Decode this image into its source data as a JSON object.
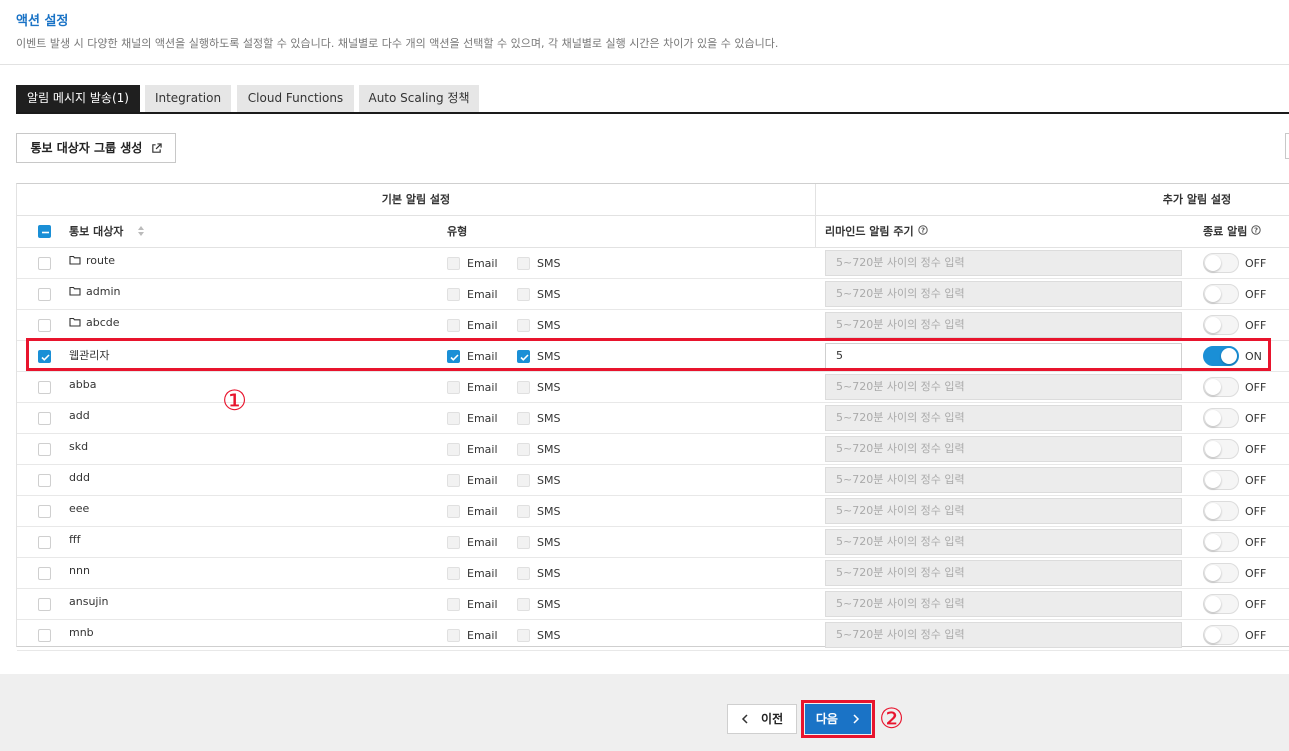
{
  "header": {
    "title": "액션 설정",
    "description": "이벤트 발생 시 다양한 채널의 액션을 실행하도록 설정할 수 있습니다. 채널별로 다수 개의 액션을 선택할 수 있으며, 각 채널별로 실행 시간은 차이가 있을 수 있습니다."
  },
  "tabs": [
    {
      "label": "알림 메시지 발송(1)",
      "active": true
    },
    {
      "label": "Integration",
      "active": false
    },
    {
      "label": "Cloud Functions",
      "active": false
    },
    {
      "label": "Auto Scaling 정책",
      "active": false
    }
  ],
  "group_button": {
    "label": "통보 대상자 그룹 생성"
  },
  "table": {
    "group_headers": {
      "basic": "기본 알림 설정",
      "additional": "추가 알림 설정"
    },
    "columns": {
      "recipient": "통보 대상자",
      "type": "유형",
      "reminder": "리마인드 알림 주기",
      "end_alert": "종료 알림"
    },
    "email_label": "Email",
    "sms_label": "SMS",
    "interval_placeholder": "5~720분 사이의 정수 입력",
    "rows": [
      {
        "name": "route",
        "folder": true,
        "checked": false,
        "interval": "",
        "end": "OFF"
      },
      {
        "name": "admin",
        "folder": true,
        "checked": false,
        "interval": "",
        "end": "OFF"
      },
      {
        "name": "abcde",
        "folder": true,
        "checked": false,
        "interval": "",
        "end": "OFF"
      },
      {
        "name": "웹관리자",
        "folder": false,
        "checked": true,
        "interval": "5",
        "end": "ON"
      },
      {
        "name": "abba",
        "folder": false,
        "checked": false,
        "interval": "",
        "end": "OFF"
      },
      {
        "name": "add",
        "folder": false,
        "checked": false,
        "interval": "",
        "end": "OFF"
      },
      {
        "name": "skd",
        "folder": false,
        "checked": false,
        "interval": "",
        "end": "OFF"
      },
      {
        "name": "ddd",
        "folder": false,
        "checked": false,
        "interval": "",
        "end": "OFF"
      },
      {
        "name": "eee",
        "folder": false,
        "checked": false,
        "interval": "",
        "end": "OFF"
      },
      {
        "name": "fff",
        "folder": false,
        "checked": false,
        "interval": "",
        "end": "OFF"
      },
      {
        "name": "nnn",
        "folder": false,
        "checked": false,
        "interval": "",
        "end": "OFF"
      },
      {
        "name": "ansujin",
        "folder": false,
        "checked": false,
        "interval": "",
        "end": "OFF"
      },
      {
        "name": "mnb",
        "folder": false,
        "checked": false,
        "interval": "",
        "end": "OFF"
      }
    ]
  },
  "annotations": {
    "marker1": "①",
    "marker2": "②"
  },
  "footer": {
    "prev_label": "이전",
    "next_label": "다음"
  },
  "colors": {
    "accent": "#1a73c6",
    "highlight": "#e8142d",
    "checkbox": "#1a8fd6"
  }
}
